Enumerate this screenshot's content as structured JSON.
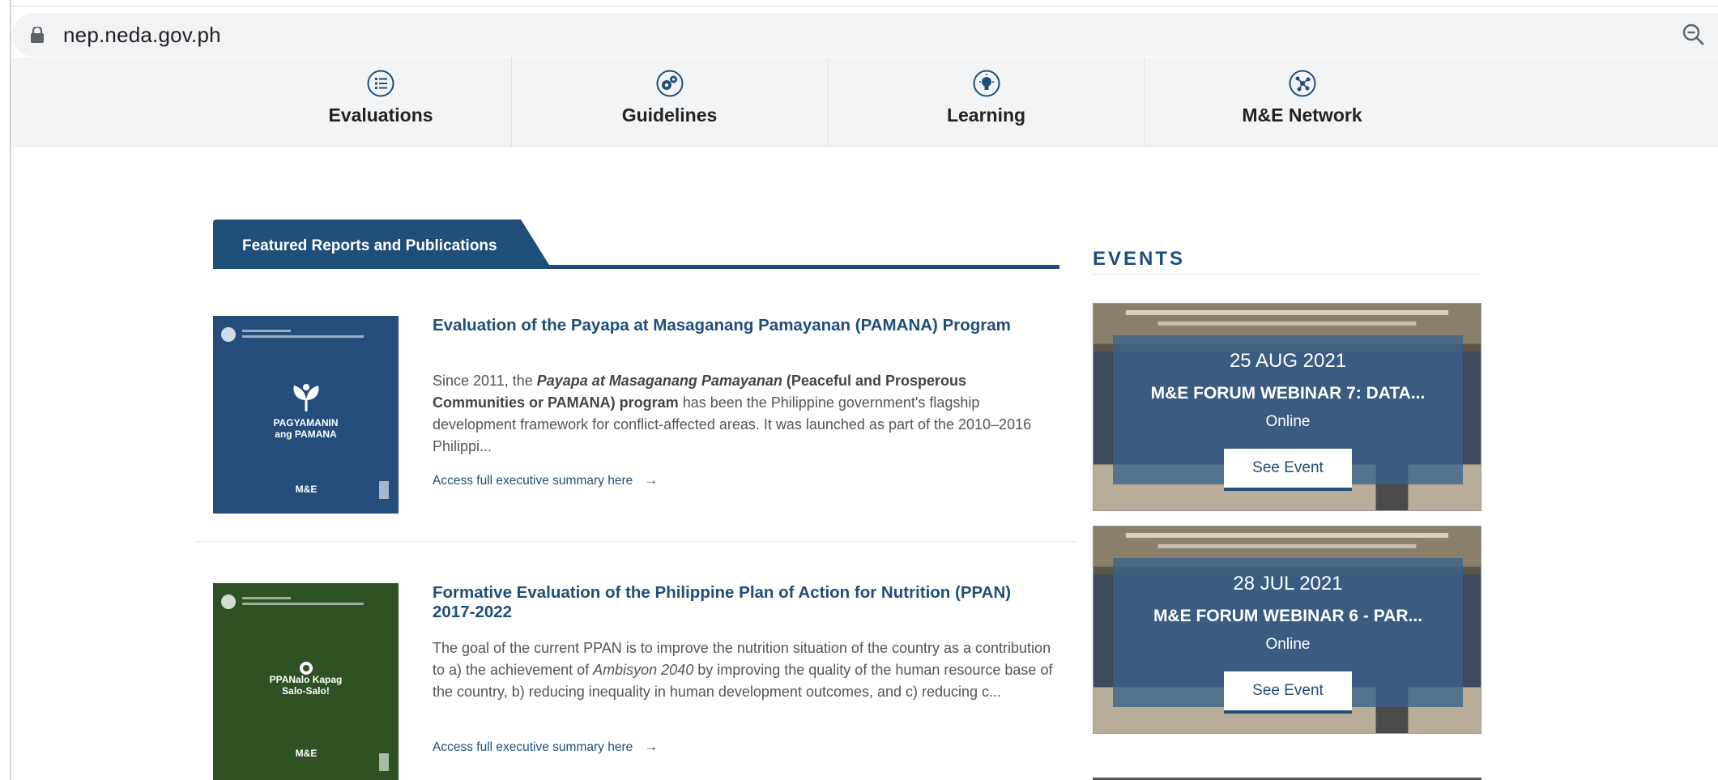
{
  "browser": {
    "url": "nep.neda.gov.ph",
    "icons": {
      "lock": "lock-icon",
      "zoom": "zoom-out-icon"
    }
  },
  "nav": {
    "items": [
      {
        "label": "Evaluations",
        "icon": "list-icon"
      },
      {
        "label": "Guidelines",
        "icon": "gears-icon"
      },
      {
        "label": "Learning",
        "icon": "lightbulb-icon"
      },
      {
        "label": "M&E Network",
        "icon": "network-icon"
      }
    ]
  },
  "featured": {
    "tab_label": "Featured Reports and Publications",
    "reports": [
      {
        "title": "Evaluation of the Payapa at Masaganang Pamayanan (PAMANA) Program",
        "summary_parts": [
          {
            "text": "Since 2011, the ",
            "style": "normal"
          },
          {
            "text": "Payapa at Masaganang Pamayanan",
            "style": "bold-italic"
          },
          {
            "text": " (Peaceful and Prosperous Communities or PAMANA) program",
            "style": "bold"
          },
          {
            "text": " has been the Philippine government's flagship development framework for conflict-affected areas. It was launched as part of the 2010–2016 Philippi...",
            "style": "normal"
          }
        ],
        "link": "Access full executive summary here",
        "cover": {
          "title_line1": "PAGYAMANIN",
          "title_line2": "ang PAMANA",
          "mark": "M&E",
          "color": "#244d7c"
        }
      },
      {
        "title": "Formative Evaluation of the Philippine Plan of Action for Nutrition (PPAN) 2017-2022",
        "summary_parts": [
          {
            "text": "The goal of the current PPAN is to improve the nutrition situation of the country as a contribution to a) the achievement of ",
            "style": "normal"
          },
          {
            "text": "Ambisyon 2040",
            "style": "italic"
          },
          {
            "text": " by improving the quality of the human resource base of the country, b) reducing inequality in human development outcomes, and c) reducing c...",
            "style": "normal"
          }
        ],
        "link": "Access full executive summary here",
        "cover": {
          "title_line1": "PPANalo Kapag",
          "title_line2": "Salo-Salo!",
          "mark": "M&E",
          "color": "#2e5223"
        }
      }
    ],
    "link_arrow": "→"
  },
  "events": {
    "heading": "EVENTS",
    "items": [
      {
        "date": "25 AUG 2021",
        "name": "M&E FORUM WEBINAR 7: DATA...",
        "location": "Online",
        "button": "See Event"
      },
      {
        "date": "28 JUL 2021",
        "name": "M&E FORUM WEBINAR 6 - PAR...",
        "location": "Online",
        "button": "See Event"
      }
    ]
  }
}
